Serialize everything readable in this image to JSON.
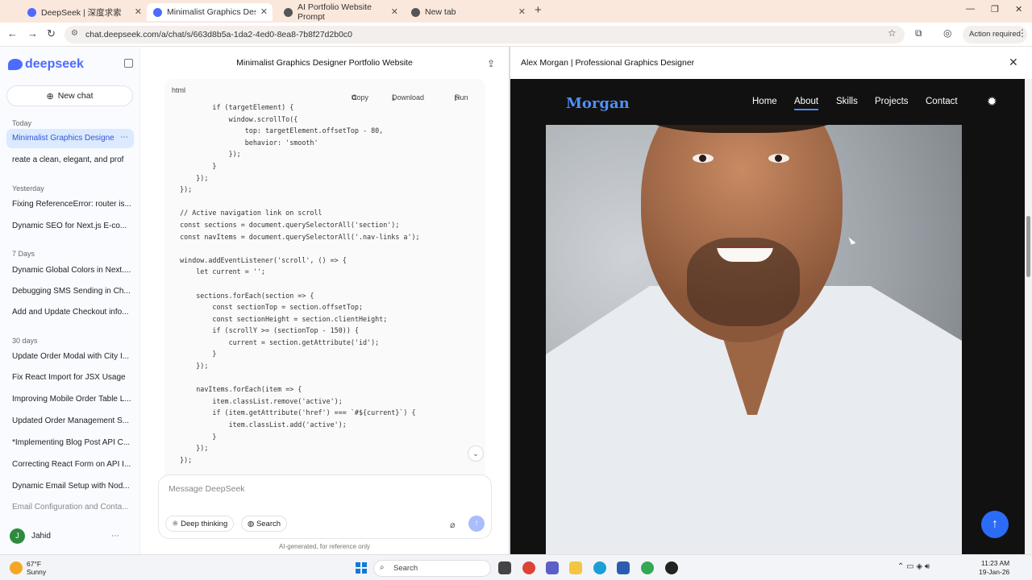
{
  "browser": {
    "tabs": [
      {
        "title": "DeepSeek | 深度求索",
        "color": "#4d6bfe"
      },
      {
        "title": "Minimalist Graphics Designer P",
        "color": "#4d6bfe"
      },
      {
        "title": "AI Portfolio Website Prompt",
        "color": "#555555"
      },
      {
        "title": "New tab",
        "color": "#555555"
      }
    ],
    "url": "chat.deepseek.com/a/chat/s/663d8b5a-1da2-4ed0-8ea8-7b8f27d2b0c0",
    "action_required": "Action required"
  },
  "sidebar": {
    "logo": "deepseek",
    "new_chat": "New chat",
    "sections": [
      {
        "label": "Today",
        "items": [
          "Minimalist Graphics Designe",
          "reate a clean, elegant, and prof"
        ]
      },
      {
        "label": "Yesterday",
        "items": [
          "Fixing ReferenceError: router is...",
          "Dynamic SEO for Next.js E-co..."
        ]
      },
      {
        "label": "7 Days",
        "items": [
          "Dynamic Global Colors in Next....",
          "Debugging SMS Sending in Ch...",
          "Add and Update Checkout info..."
        ]
      },
      {
        "label": "30 days",
        "items": [
          "Update Order Modal with City I...",
          "Fix React Import for JSX Usage",
          "Improving Mobile Order Table L...",
          "Updated Order Management S...",
          "*Implementing Blog Post API C...",
          "Correcting React Form on API I...",
          "Dynamic Email Setup with Nod...",
          "Email Configuration and Conta..."
        ]
      }
    ],
    "user": {
      "initial": "J",
      "name": "Jahid"
    }
  },
  "chat": {
    "title": "Minimalist Graphics Designer Portfolio Website",
    "code_block": {
      "language": "html",
      "copy": "Copy",
      "download": "Download",
      "run": "Run",
      "code": "          if (targetElement) {\n              window.scrollTo({\n                  top: targetElement.offsetTop - 80,\n                  behavior: 'smooth'\n              });\n          }\n      });\n  });\n\n  // Active navigation link on scroll\n  const sections = document.querySelectorAll('section');\n  const navItems = document.querySelectorAll('.nav-links a');\n\n  window.addEventListener('scroll', () => {\n      let current = '';\n\n      sections.forEach(section => {\n          const sectionTop = section.offsetTop;\n          const sectionHeight = section.clientHeight;\n          if (scrollY >= (sectionTop - 150)) {\n              current = section.getAttribute('id');\n          }\n      });\n\n      navItems.forEach(item => {\n          item.classList.remove('active');\n          if (item.getAttribute('href') === `#${current}`) {\n              item.classList.add('active');\n          }\n      });\n  });"
    },
    "input_placeholder": "Message DeepSeek",
    "deep_thinking": "Deep thinking",
    "search": "Search",
    "disclaimer": "AI-generated, for reference only"
  },
  "preview": {
    "window_title": "Alex Morgan | Professional Graphics Designer",
    "brand": "Morgan",
    "nav": [
      "Home",
      "About",
      "Skills",
      "Projects",
      "Contact"
    ],
    "active_nav": "About",
    "accent_color": "#4f8ff7"
  },
  "taskbar": {
    "weather_temp": "67°F",
    "weather_desc": "Sunny",
    "search": "Search",
    "time": "11:23 AM",
    "date": "19-Jan-26"
  }
}
